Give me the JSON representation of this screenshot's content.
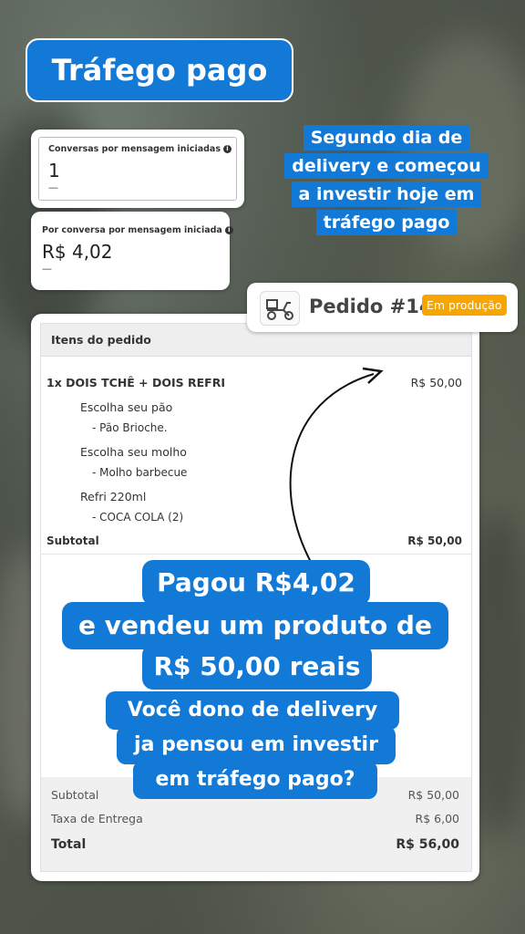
{
  "title": "Tráfego pago",
  "metrics": [
    {
      "label": "Conversas por mensagem iniciadas",
      "value": "1",
      "sub": "—"
    },
    {
      "label": "Por conversa por mensagem iniciada",
      "value": "R$ 4,02",
      "sub": "—"
    }
  ],
  "info_symbol": "i",
  "callout": {
    "lines": [
      "Segundo dia de",
      "delivery e começou",
      "a investir hoje em",
      "tráfego pago"
    ]
  },
  "order": {
    "title": "Pedido #14",
    "status": "Em produção",
    "status_color": "#f7a500",
    "items_header": "Itens do pedido",
    "item": {
      "name": "1x DOIS TCHÊ + DOIS REFRI",
      "price": "R$ 50,00"
    },
    "options": [
      {
        "group": "Escolha seu pão",
        "choice": "- Pão Brioche."
      },
      {
        "group": "Escolha seu molho",
        "choice": "- Molho barbecue"
      },
      {
        "group": "Refri 220ml",
        "choice": "- COCA COLA (2)"
      }
    ],
    "item_subtotal_label": "Subtotal",
    "item_subtotal_value": "R$ 50,00",
    "totals": {
      "subtotal_label": "Subtotal",
      "subtotal_value": "R$ 50,00",
      "delivery_label": "Taxa de Entrega",
      "delivery_value": "R$ 6,00",
      "total_label": "Total",
      "total_value": "R$ 56,00"
    }
  },
  "overlay": {
    "big": [
      "Pagou R$4,02",
      "e vendeu um produto de",
      "R$ 50,00 reais"
    ],
    "small": [
      "Você dono de delivery",
      "ja pensou em investir",
      "em tráfego pago?"
    ]
  },
  "colors": {
    "accent_blue": "#1279d6",
    "badge_orange": "#f7a500"
  },
  "icons": [
    "info-icon",
    "delivery-motorcycle-icon",
    "curved-arrow"
  ]
}
